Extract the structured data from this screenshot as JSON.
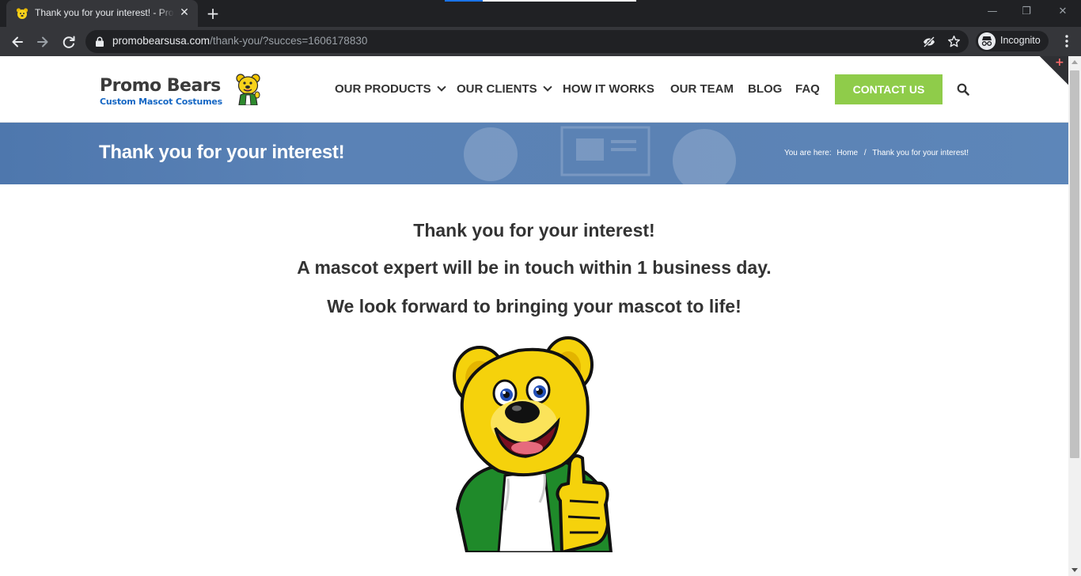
{
  "browser": {
    "tab_title": "Thank you for your interest! - Promo Bears",
    "url_host": "promobearsusa.com",
    "url_path": "/thank-you/?succes=1606178830",
    "profile_label": "Incognito"
  },
  "site": {
    "logo_title": "Promo Bears",
    "logo_subtitle": "Custom Mascot Costumes",
    "nav": {
      "products": "OUR PRODUCTS",
      "clients": "OUR CLIENTS",
      "how": "HOW IT WORKS",
      "team": "OUR TEAM",
      "blog": "BLOG",
      "faq": "FAQ",
      "contact": "CONTACT US"
    },
    "colors": {
      "accent_green": "#8fcc4a",
      "banner_blue": "#5a82b6",
      "logo_blue": "#1567c4"
    }
  },
  "banner": {
    "title": "Thank you for your interest!",
    "crumb_prefix": "You are here:",
    "crumb_home": "Home",
    "crumb_separator": "/",
    "crumb_current": "Thank you for your interest!"
  },
  "content": {
    "line1": "Thank you for your interest!",
    "line2": "A mascot  expert will be in touch within 1 business day.",
    "line3": "We look forward to bringing your mascot to life!"
  },
  "icons": {
    "back": "back-arrow-icon",
    "forward": "forward-arrow-icon",
    "reload": "reload-icon",
    "lock": "lock-icon",
    "eye": "eye-off-icon",
    "star": "star-icon",
    "menu": "kebab-menu-icon",
    "search": "search-icon"
  }
}
